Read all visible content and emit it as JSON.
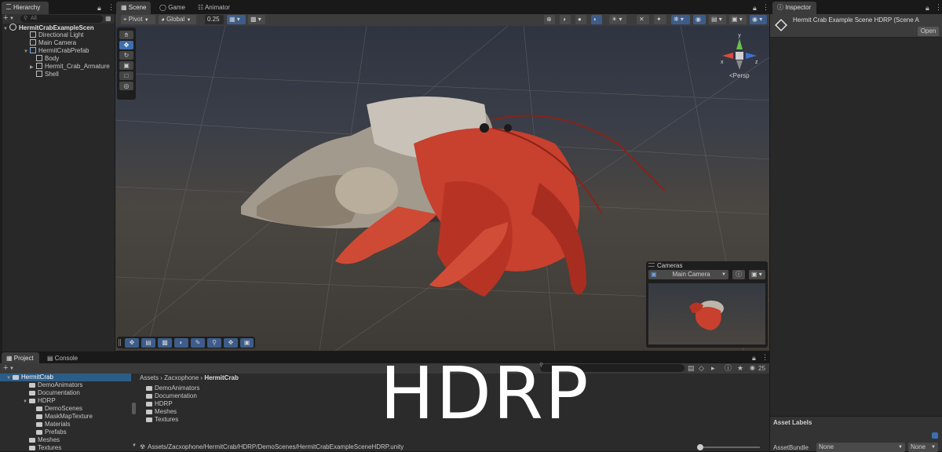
{
  "hierarchy": {
    "tab": "Hierarchy",
    "search_placeholder": "All",
    "items": [
      {
        "label": "HermitCrabExampleScen",
        "kind": "scene"
      },
      {
        "label": "Directional Light",
        "kind": "object"
      },
      {
        "label": "Main Camera",
        "kind": "object"
      },
      {
        "label": "HermitCrabPrefab",
        "kind": "prefab"
      },
      {
        "label": "Body",
        "kind": "object"
      },
      {
        "label": "Hermit_Crab_Armature",
        "kind": "object"
      },
      {
        "label": "Shell",
        "kind": "object"
      }
    ]
  },
  "scene_tabs": [
    "Scene",
    "Game",
    "Animator"
  ],
  "scene_toolbar": {
    "pivot": "Pivot",
    "global": "Global",
    "snap_value": "0.25"
  },
  "gizmo": {
    "axis_y": "y",
    "axis_x": "x",
    "axis_z": "z",
    "projection": "Persp"
  },
  "cameras_overlay": {
    "title": "Cameras",
    "selected_camera": "Main Camera"
  },
  "inspector": {
    "tab": "Inspector",
    "object_title": "Hermit Crab Example Scene HDRP (Scene A",
    "open_button": "Open",
    "asset_labels": "Asset Labels",
    "asset_bundle_label": "AssetBundle",
    "asset_bundle_value": "None",
    "asset_variant_value": "None"
  },
  "bottom_tabs": [
    "Project",
    "Console"
  ],
  "project": {
    "tree": [
      {
        "label": "HermitCrab",
        "level": 0,
        "selected": true
      },
      {
        "label": "DemoAnimators",
        "level": 1
      },
      {
        "label": "Documentation",
        "level": 1
      },
      {
        "label": "HDRP",
        "level": 1
      },
      {
        "label": "DemoScenes",
        "level": 2
      },
      {
        "label": "MaskMapTexture",
        "level": 2
      },
      {
        "label": "Materials",
        "level": 2
      },
      {
        "label": "Prefabs",
        "level": 2
      },
      {
        "label": "Meshes",
        "level": 1
      },
      {
        "label": "Textures",
        "level": 1
      }
    ],
    "breadcrumb": [
      "Assets",
      "Zacxophone",
      "HermitCrab"
    ],
    "folders": [
      "DemoAnimators",
      "Documentation",
      "HDRP",
      "Meshes",
      "Textures"
    ],
    "hidden_count": "25",
    "status_path": "Assets/Zacxophone/HermitCrab/HDRP/DemoScenes/HermitCrabExampleSceneHDRP.unity"
  },
  "overlay_text": "HDRP",
  "colors": {
    "accent_blue": "#3d6fb0",
    "selection": "#2c5d87",
    "panel": "#282828",
    "crab_red": "#c8402e"
  }
}
